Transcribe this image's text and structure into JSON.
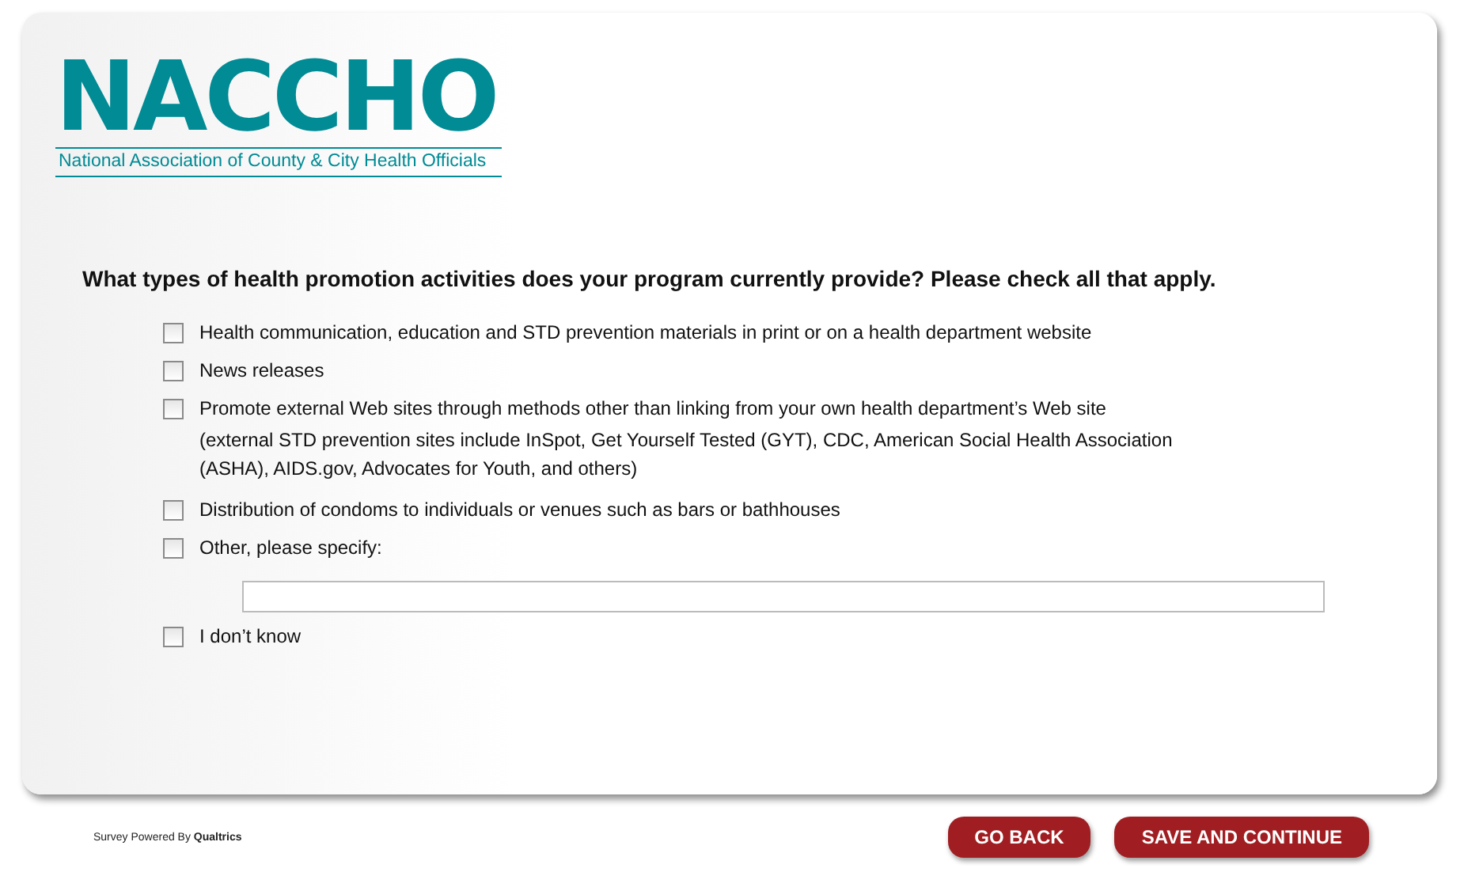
{
  "logo": {
    "name": "NACCHO",
    "tagline": "National Association of County & City Health Officials"
  },
  "question": "What types of health promotion activities does your program currently provide? Please check all that apply.",
  "options": [
    {
      "kind": "plain",
      "label": "Health communication, education and STD prevention materials in print or on a health department website",
      "checked": false
    },
    {
      "kind": "plain",
      "label": "News releases",
      "checked": false
    },
    {
      "kind": "detail",
      "label": "Promote external Web sites through methods other than linking from your own health department’s Web site",
      "detail": "(external STD prevention sites include InSpot, Get Yourself Tested (GYT), CDC, American Social Health Association (ASHA), AIDS.gov, Advocates for Youth, and others)",
      "checked": false
    },
    {
      "kind": "plain",
      "label": "Distribution of condoms to individuals or venues such as bars or bathhouses",
      "checked": false
    },
    {
      "kind": "text_entry",
      "label": "Other, please specify:",
      "checked": false
    },
    {
      "kind": "plain",
      "label": "I don’t know",
      "checked": false
    }
  ],
  "footer": {
    "credit": "Survey Powered By **Qualtrics**",
    "buttons": [
      "GO BACK",
      "SAVE AND CONTINUE"
    ]
  }
}
